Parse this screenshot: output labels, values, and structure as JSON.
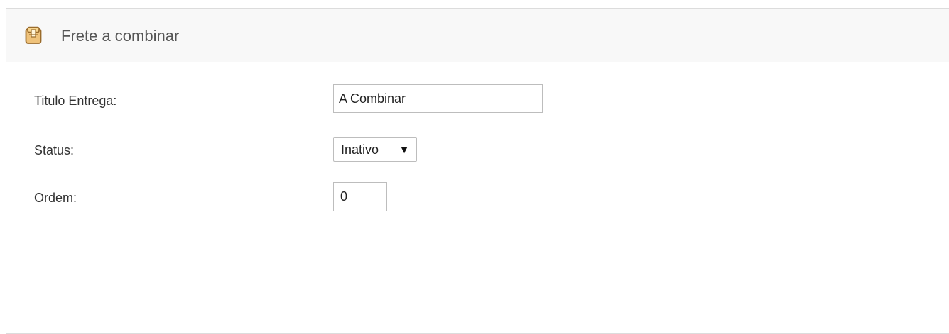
{
  "header": {
    "icon": "package-box-icon",
    "title": "Frete a combinar"
  },
  "form": {
    "title_label": "Titulo Entrega:",
    "title_value": "A Combinar",
    "status_label": "Status:",
    "status_value": "Inativo",
    "status_options": [
      "Inativo"
    ],
    "order_label": "Ordem:",
    "order_value": "0"
  },
  "colors": {
    "header_bg": "#f8f8f8",
    "border": "#dcdcdc",
    "icon_box": "#e7b264"
  }
}
